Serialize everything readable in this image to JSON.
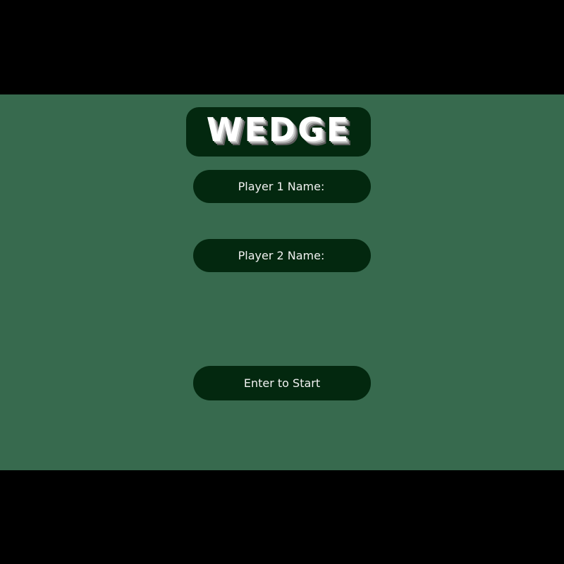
{
  "game": {
    "title": "WEDGE",
    "player1_label": "Player 1 Name:",
    "player1_value": "",
    "player2_label": "Player 2 Name:",
    "player2_value": "",
    "start_label": "Enter to Start"
  },
  "colors": {
    "background": "#376a4e",
    "panel": "#03280f",
    "text": "#f2f2f2",
    "letterbox": "#000000"
  }
}
